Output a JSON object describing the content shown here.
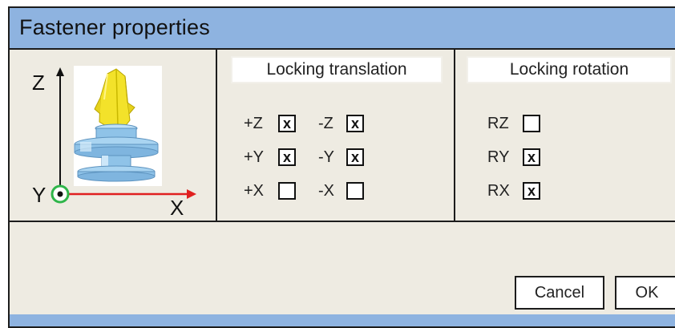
{
  "window": {
    "title": "Fastener properties"
  },
  "axes": {
    "z_label": "Z",
    "y_label": "Y",
    "x_label": "X"
  },
  "translation": {
    "header": "Locking translation",
    "items": [
      {
        "label": "+Z",
        "checked": true,
        "mark": "x"
      },
      {
        "label": "-Z",
        "checked": true,
        "mark": "x"
      },
      {
        "label": "+Y",
        "checked": true,
        "mark": "x"
      },
      {
        "label": "-Y",
        "checked": true,
        "mark": "x"
      },
      {
        "label": "+X",
        "checked": false,
        "mark": ""
      },
      {
        "label": "-X",
        "checked": false,
        "mark": ""
      }
    ]
  },
  "rotation": {
    "header": "Locking rotation",
    "items": [
      {
        "label": "RZ",
        "checked": false,
        "mark": ""
      },
      {
        "label": "RY",
        "checked": true,
        "mark": "x"
      },
      {
        "label": "RX",
        "checked": true,
        "mark": "x"
      }
    ]
  },
  "buttons": {
    "cancel": "Cancel",
    "ok": "OK"
  },
  "colors": {
    "titlebar": "#8eb3e0",
    "panel": "#eeebe2",
    "fastener_body": "#8fc3e8",
    "fastener_clip": "#f3e22a",
    "x_axis": "#e02020",
    "y_axis_ring": "#2fb54a"
  }
}
